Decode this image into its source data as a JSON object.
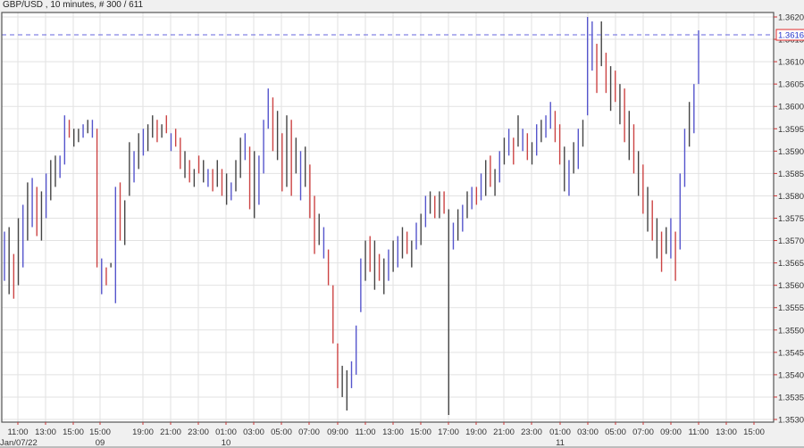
{
  "title": "GBP/USD , 10 minutes, # 300 / 611",
  "chart_data": {
    "type": "ohlc-range-bars",
    "symbol": "GBP/USD",
    "interval": "10 minutes",
    "bar_counter": "# 300 / 611",
    "ylim": [
      1.353,
      1.362
    ],
    "yticks": [
      "1.3620",
      "1.3615",
      "1.3610",
      "1.3605",
      "1.3600",
      "1.3595",
      "1.3590",
      "1.3585",
      "1.3580",
      "1.3575",
      "1.3570",
      "1.3565",
      "1.3560",
      "1.3555",
      "1.3550",
      "1.3545",
      "1.3540",
      "1.3535",
      "1.3530"
    ],
    "xticks": [
      "11:00",
      "13:00",
      "15:00",
      "15:00",
      "19:00",
      "21:00",
      "23:00",
      "01:00",
      "03:00",
      "05:00",
      "07:00",
      "09:00",
      "11:00",
      "13:00",
      "15:00",
      "17:00",
      "19:00",
      "21:00",
      "23:00",
      "01:00",
      "03:00",
      "05:00",
      "07:00",
      "09:00",
      "11:00",
      "13:00",
      "15:00"
    ],
    "date_labels": [
      {
        "tick_index": 0,
        "text": "Jan/07/22"
      },
      {
        "tick_index": 3,
        "text": "09"
      },
      {
        "tick_index": 7,
        "text": "10"
      },
      {
        "tick_index": 19,
        "text": "11"
      }
    ],
    "current_price": "1.3616",
    "colors": {
      "up": "#5555cc",
      "down": "#cc4444",
      "neutral": "#444444",
      "price_line": "#6666dd",
      "price_box": "#e03030"
    },
    "bars": [
      [
        1.3572,
        1.3561,
        "u"
      ],
      [
        1.3573,
        1.3558,
        "n"
      ],
      [
        1.3567,
        1.3557,
        "d"
      ],
      [
        1.3575,
        1.356,
        "n"
      ],
      [
        1.3578,
        1.3564,
        "u"
      ],
      [
        1.3583,
        1.357,
        "n"
      ],
      [
        1.3584,
        1.3573,
        "u"
      ],
      [
        1.3582,
        1.3571,
        "d"
      ],
      [
        1.3581,
        1.357,
        "n"
      ],
      [
        1.3585,
        1.3575,
        "u"
      ],
      [
        1.3588,
        1.3579,
        "n"
      ],
      [
        1.3589,
        1.3582,
        "n"
      ],
      [
        1.3589,
        1.3584,
        "u"
      ],
      [
        1.3598,
        1.3587,
        "u"
      ],
      [
        1.3597,
        1.3593,
        "d"
      ],
      [
        1.3595,
        1.3591,
        "n"
      ],
      [
        1.3595,
        1.3592,
        "n"
      ],
      [
        1.3596,
        1.3593,
        "u"
      ],
      [
        1.3597,
        1.3594,
        "n"
      ],
      [
        1.3597,
        1.3593,
        "u"
      ],
      [
        1.3595,
        1.3564,
        "d"
      ],
      [
        1.3566,
        1.3558,
        "u"
      ],
      [
        1.3564,
        1.356,
        "d"
      ],
      [
        1.3565,
        1.3564,
        "n"
      ],
      [
        1.3582,
        1.3556,
        "u"
      ],
      [
        1.3583,
        1.357,
        "d"
      ],
      [
        1.3579,
        1.3569,
        "n"
      ],
      [
        1.3592,
        1.358,
        "n"
      ],
      [
        1.359,
        1.3583,
        "u"
      ],
      [
        1.3594,
        1.3586,
        "n"
      ],
      [
        1.3595,
        1.3589,
        "u"
      ],
      [
        1.3596,
        1.359,
        "n"
      ],
      [
        1.3598,
        1.3593,
        "n"
      ],
      [
        1.3597,
        1.3592,
        "d"
      ],
      [
        1.3596,
        1.3593,
        "n"
      ],
      [
        1.3598,
        1.3594,
        "d"
      ],
      [
        1.3594,
        1.359,
        "u"
      ],
      [
        1.3595,
        1.3591,
        "d"
      ],
      [
        1.3593,
        1.3586,
        "d"
      ],
      [
        1.359,
        1.3584,
        "n"
      ],
      [
        1.3588,
        1.3583,
        "d"
      ],
      [
        1.3586,
        1.3582,
        "n"
      ],
      [
        1.3589,
        1.3585,
        "d"
      ],
      [
        1.3588,
        1.3583,
        "n"
      ],
      [
        1.3586,
        1.3582,
        "u"
      ],
      [
        1.3586,
        1.3581,
        "d"
      ],
      [
        1.3588,
        1.3582,
        "n"
      ],
      [
        1.3586,
        1.358,
        "d"
      ],
      [
        1.3585,
        1.3578,
        "n"
      ],
      [
        1.3583,
        1.3579,
        "u"
      ],
      [
        1.3588,
        1.3581,
        "n"
      ],
      [
        1.3593,
        1.3584,
        "n"
      ],
      [
        1.3594,
        1.3588,
        "u"
      ],
      [
        1.3591,
        1.3577,
        "d"
      ],
      [
        1.359,
        1.3575,
        "n"
      ],
      [
        1.3589,
        1.3578,
        "u"
      ],
      [
        1.3597,
        1.3585,
        "u"
      ],
      [
        1.3604,
        1.3595,
        "u"
      ],
      [
        1.3602,
        1.359,
        "d"
      ],
      [
        1.3599,
        1.3588,
        "n"
      ],
      [
        1.3594,
        1.3581,
        "d"
      ],
      [
        1.3598,
        1.3582,
        "n"
      ],
      [
        1.3597,
        1.358,
        "d"
      ],
      [
        1.3593,
        1.3585,
        "n"
      ],
      [
        1.359,
        1.3579,
        "u"
      ],
      [
        1.3591,
        1.3582,
        "n"
      ],
      [
        1.3587,
        1.3575,
        "d"
      ],
      [
        1.358,
        1.3567,
        "d"
      ],
      [
        1.3576,
        1.3569,
        "n"
      ],
      [
        1.3573,
        1.3566,
        "u"
      ],
      [
        1.3568,
        1.356,
        "d"
      ],
      [
        1.356,
        1.3547,
        "d"
      ],
      [
        1.3547,
        1.3537,
        "d"
      ],
      [
        1.3542,
        1.3535,
        "n"
      ],
      [
        1.3541,
        1.3532,
        "n"
      ],
      [
        1.3543,
        1.3537,
        "u"
      ],
      [
        1.3551,
        1.354,
        "u"
      ],
      [
        1.3566,
        1.3554,
        "u"
      ],
      [
        1.357,
        1.3561,
        "n"
      ],
      [
        1.3571,
        1.3563,
        "d"
      ],
      [
        1.357,
        1.3559,
        "n"
      ],
      [
        1.3567,
        1.3561,
        "d"
      ],
      [
        1.3566,
        1.3558,
        "n"
      ],
      [
        1.3568,
        1.3561,
        "u"
      ],
      [
        1.357,
        1.3563,
        "n"
      ],
      [
        1.3571,
        1.3564,
        "u"
      ],
      [
        1.3573,
        1.3566,
        "n"
      ],
      [
        1.3572,
        1.3567,
        "d"
      ],
      [
        1.357,
        1.3564,
        "n"
      ],
      [
        1.3574,
        1.3568,
        "u"
      ],
      [
        1.3576,
        1.3569,
        "n"
      ],
      [
        1.358,
        1.3573,
        "u"
      ],
      [
        1.3581,
        1.3576,
        "n"
      ],
      [
        1.358,
        1.3575,
        "d"
      ],
      [
        1.3581,
        1.3575,
        "n"
      ],
      [
        1.3581,
        1.3576,
        "d"
      ],
      [
        1.3577,
        1.3531,
        "n"
      ],
      [
        1.3574,
        1.3568,
        "u"
      ],
      [
        1.3577,
        1.357,
        "n"
      ],
      [
        1.3578,
        1.3572,
        "u"
      ],
      [
        1.3581,
        1.3575,
        "n"
      ],
      [
        1.3582,
        1.3577,
        "u"
      ],
      [
        1.3582,
        1.3578,
        "d"
      ],
      [
        1.3585,
        1.3579,
        "u"
      ],
      [
        1.3588,
        1.358,
        "n"
      ],
      [
        1.3589,
        1.3582,
        "d"
      ],
      [
        1.3586,
        1.358,
        "n"
      ],
      [
        1.359,
        1.3583,
        "u"
      ],
      [
        1.3593,
        1.3587,
        "n"
      ],
      [
        1.3595,
        1.3589,
        "u"
      ],
      [
        1.3593,
        1.3587,
        "d"
      ],
      [
        1.3598,
        1.3591,
        "n"
      ],
      [
        1.3595,
        1.359,
        "u"
      ],
      [
        1.3594,
        1.3588,
        "d"
      ],
      [
        1.3592,
        1.3587,
        "n"
      ],
      [
        1.3596,
        1.3589,
        "u"
      ],
      [
        1.3597,
        1.3592,
        "n"
      ],
      [
        1.3598,
        1.3593,
        "u"
      ],
      [
        1.3601,
        1.3595,
        "u"
      ],
      [
        1.3599,
        1.3592,
        "d"
      ],
      [
        1.3596,
        1.3587,
        "d"
      ],
      [
        1.3591,
        1.3581,
        "n"
      ],
      [
        1.3588,
        1.358,
        "u"
      ],
      [
        1.3592,
        1.3585,
        "n"
      ],
      [
        1.3595,
        1.3586,
        "u"
      ],
      [
        1.3597,
        1.3591,
        "n"
      ],
      [
        1.362,
        1.3598,
        "u"
      ],
      [
        1.3619,
        1.3608,
        "u"
      ],
      [
        1.3614,
        1.3603,
        "d"
      ],
      [
        1.3619,
        1.3609,
        "n"
      ],
      [
        1.3612,
        1.3603,
        "d"
      ],
      [
        1.3609,
        1.3599,
        "n"
      ],
      [
        1.3608,
        1.3601,
        "d"
      ],
      [
        1.3605,
        1.3596,
        "n"
      ],
      [
        1.3604,
        1.3592,
        "d"
      ],
      [
        1.3599,
        1.3588,
        "n"
      ],
      [
        1.3596,
        1.3585,
        "d"
      ],
      [
        1.359,
        1.358,
        "n"
      ],
      [
        1.3587,
        1.3576,
        "d"
      ],
      [
        1.3582,
        1.3572,
        "n"
      ],
      [
        1.3579,
        1.357,
        "d"
      ],
      [
        1.3575,
        1.3566,
        "n"
      ],
      [
        1.3572,
        1.3563,
        "d"
      ],
      [
        1.3573,
        1.3567,
        "n"
      ],
      [
        1.3575,
        1.3566,
        "u"
      ],
      [
        1.3572,
        1.3561,
        "d"
      ],
      [
        1.3585,
        1.3568,
        "u"
      ],
      [
        1.3595,
        1.3582,
        "u"
      ],
      [
        1.3601,
        1.3591,
        "n"
      ],
      [
        1.3605,
        1.3594,
        "u"
      ],
      [
        1.3617,
        1.3605,
        "u"
      ]
    ]
  }
}
